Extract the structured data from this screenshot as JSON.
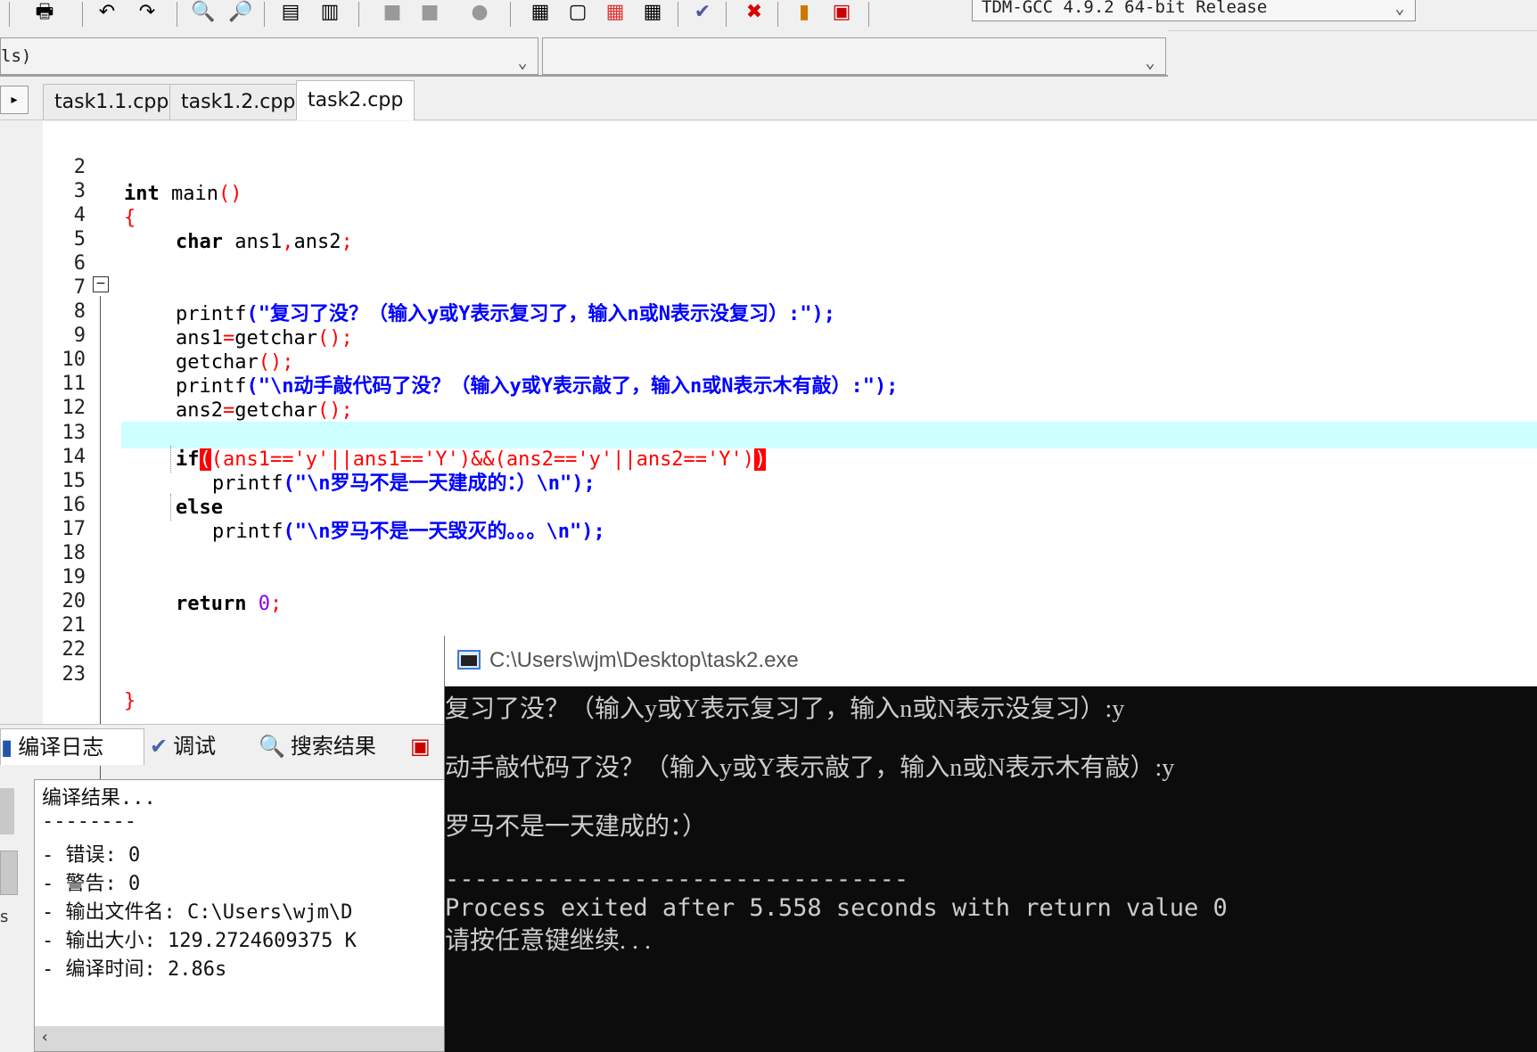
{
  "toolbar": {
    "compiler": "TDM-GCC 4.9.2 64-bit Release"
  },
  "combos": {
    "left_value": "ls)",
    "right_value": ""
  },
  "tabs": [
    {
      "label": "task1.1.cpp",
      "active": false
    },
    {
      "label": "task1.2.cpp",
      "active": false
    },
    {
      "label": "task2.cpp",
      "active": true
    }
  ],
  "editor": {
    "line_numbers": [
      "2",
      "3",
      "4",
      "5",
      "6",
      "7",
      "8",
      "9",
      "10",
      "11",
      "12",
      "13",
      "14",
      "15",
      "16",
      "17",
      "18",
      "19",
      "20",
      "21",
      "22",
      "23"
    ],
    "highlighted_line": "13",
    "code": {
      "l2_kw": "int",
      "l2_rest": " main",
      "l2_paren": "()",
      "l3": "{",
      "l4_kw": "char",
      "l4_rest": " ans1",
      "l4_comma": ",",
      "l4_rest2": "ans2",
      "l4_semi": ";",
      "l7_fn": "printf",
      "l7_str": "(\"复习了没？（输入y或Y表示复习了，输入n或N表示没复习）:\");",
      "l8_a": "ans1",
      "l8_b": "=",
      "l8_c": "getchar",
      "l8_d": "();",
      "l9_a": "getchar",
      "l9_b": "();",
      "l10_fn": "printf",
      "l10_str": "(\"\\n动手敲代码了没？（输入y或Y表示敲了，输入n或N表示木有敲）:\");",
      "l11_a": "ans2",
      "l11_b": "=",
      "l11_c": "getchar",
      "l11_d": "();",
      "l13_kw": "if",
      "l13_open": "(",
      "l13_body": "(ans1=='y'||ans1=='Y')&&(ans2=='y'||ans2=='Y')",
      "l13_close": ")",
      "l14_fn": "printf",
      "l14_str": "(\"\\n罗马不是一天建成的：）\\n\");",
      "l15_kw": "else",
      "l16_fn": "printf",
      "l16_str": "(\"\\n罗马不是一天毁灭的。。。\\n\");",
      "l19_kw": "return",
      "l19_num": " 0",
      "l19_semi": ";",
      "l23": "}"
    }
  },
  "bottom_tabs": [
    {
      "label": "编译日志",
      "icon": "chart-icon"
    },
    {
      "label": "调试",
      "icon": "check-icon"
    },
    {
      "label": "搜索结果",
      "icon": "search-icon"
    }
  ],
  "compile_log": [
    "编译结果...",
    "--------",
    "- 错误: 0",
    "- 警告: 0",
    "- 输出文件名: C:\\Users\\wjm\\D",
    "- 输出大小: 129.2724609375 K",
    "- 编译时间: 2.86s"
  ],
  "left_strip_text": "s",
  "console": {
    "title": "C:\\Users\\wjm\\Desktop\\task2.exe",
    "lines": [
      "复习了没？（输入y或Y表示复习了，输入n或N表示没复习）:y",
      "动手敲代码了没？（输入y或Y表示敲了，输入n或N表示木有敲）:y",
      "罗马不是一天建成的：）",
      "--------------------------------",
      "Process exited after 5.558 seconds with return value 0",
      "请按任意键继续. . ."
    ]
  },
  "colors": {
    "keyword": "#000000",
    "string": "#0000ff",
    "operator": "#ff0000",
    "number": "#8000ff",
    "current_line": "#ccffff",
    "console_bg": "#0c0c0c"
  }
}
